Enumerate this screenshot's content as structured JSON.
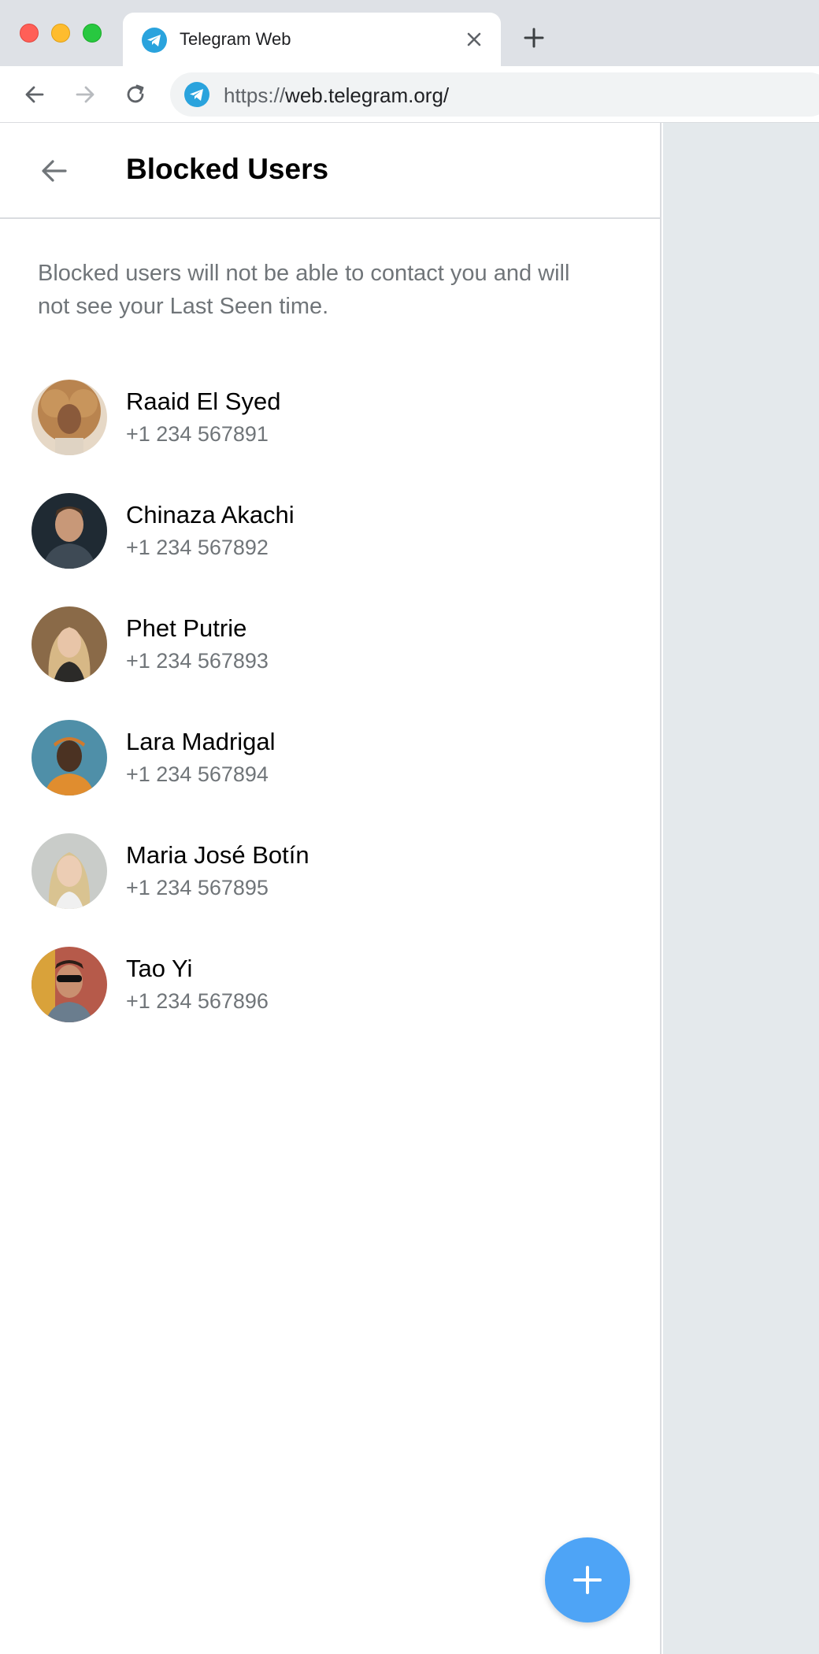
{
  "browser": {
    "tab_title": "Telegram Web",
    "url_scheme": "https://",
    "url_host": "web.telegram.org/",
    "brand_color": "#2aa3dd"
  },
  "page": {
    "title": "Blocked Users",
    "description": "Blocked users will not be able to contact you and will not see your Last Seen time."
  },
  "users": [
    {
      "name": "Raaid El Syed",
      "phone": "+1 234 567891"
    },
    {
      "name": "Chinaza Akachi",
      "phone": "+1 234 567892"
    },
    {
      "name": "Phet Putrie",
      "phone": "+1 234 567893"
    },
    {
      "name": "Lara Madrigal",
      "phone": "+1 234 567894"
    },
    {
      "name": "Maria José Botín",
      "phone": "+1 234 567895"
    },
    {
      "name": "Tao Yi",
      "phone": "+1 234 567896"
    }
  ],
  "fab": {
    "icon": "plus-icon",
    "color": "#4ea4f6"
  }
}
